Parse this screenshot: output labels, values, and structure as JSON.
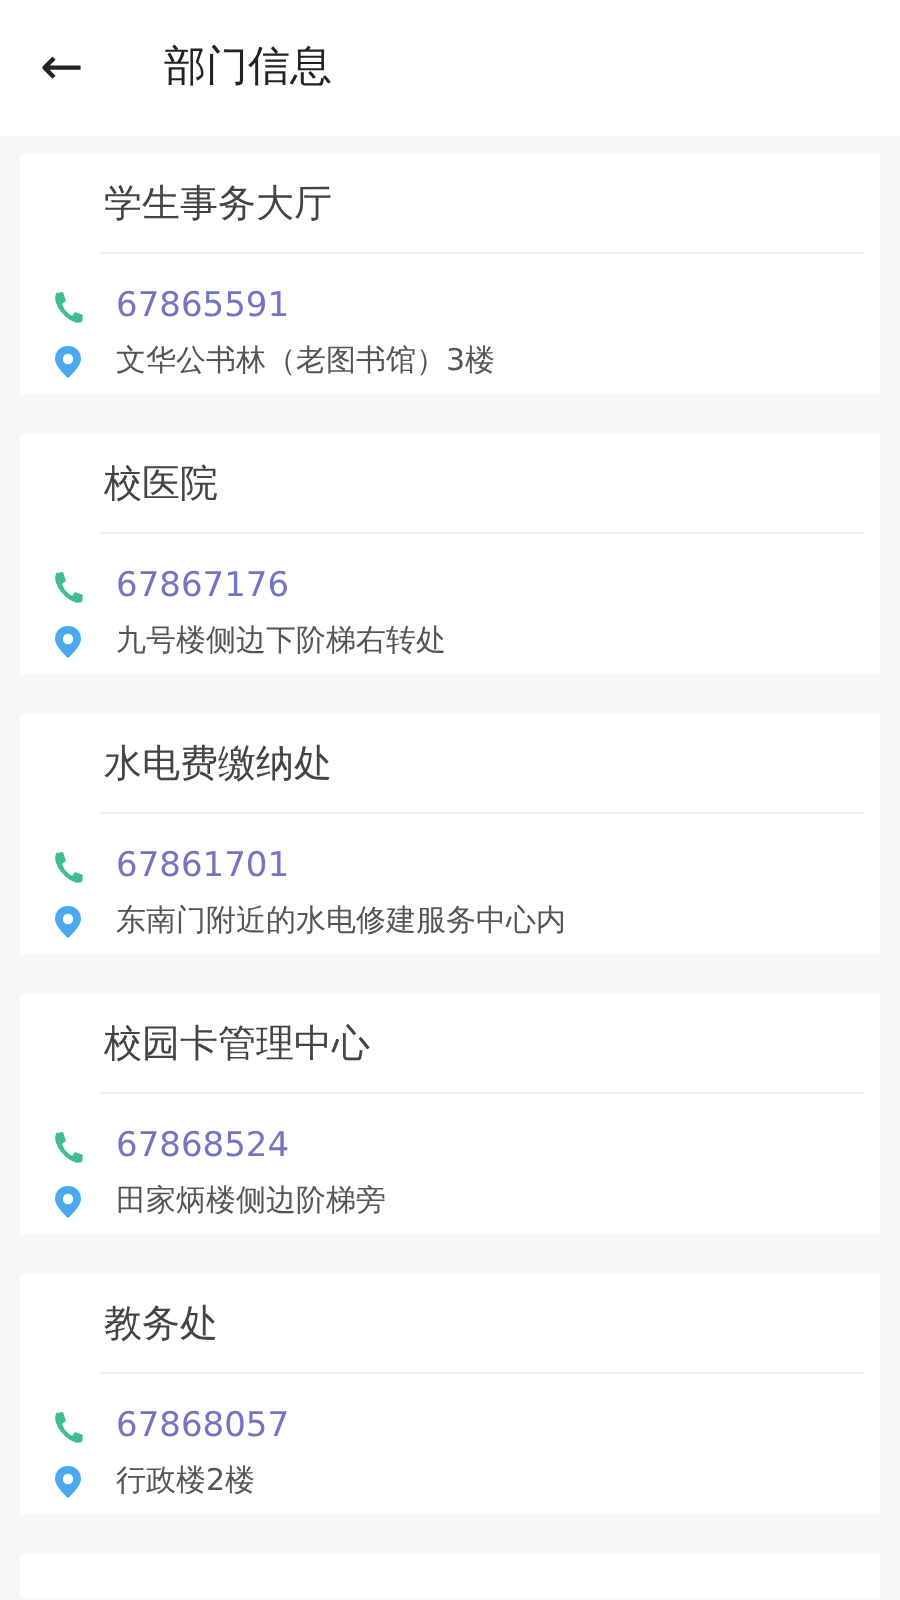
{
  "header": {
    "back": "←",
    "title": "部门信息"
  },
  "departments": [
    {
      "name": "学生事务大厅",
      "phone": "67865591",
      "address": "文华公书林（老图书馆）3楼"
    },
    {
      "name": "校医院",
      "phone": "67867176",
      "address": "九号楼侧边下阶梯右转处"
    },
    {
      "name": "水电费缴纳处",
      "phone": "67861701",
      "address": "东南门附近的水电修建服务中心内"
    },
    {
      "name": "校园卡管理中心",
      "phone": "67868524",
      "address": "田家炳楼侧边阶梯旁"
    },
    {
      "name": "教务处",
      "phone": "67868057",
      "address": "行政楼2楼"
    }
  ]
}
